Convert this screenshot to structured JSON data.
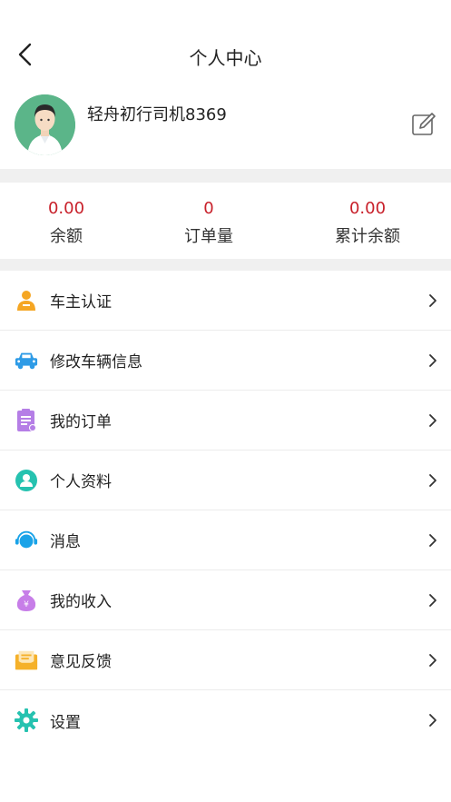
{
  "header": {
    "title": "个人中心",
    "back_icon": "back-arrow-icon"
  },
  "profile": {
    "username": "轻舟初行司机8369",
    "avatar_icon": "avatar-person-icon",
    "edit_icon": "edit-icon"
  },
  "stats": [
    {
      "value": "0.00",
      "label": "余额"
    },
    {
      "value": "0",
      "label": "订单量"
    },
    {
      "value": "0.00",
      "label": "累计余额"
    }
  ],
  "menu": [
    {
      "label": "车主认证",
      "icon": "driver-verify-icon",
      "color": "#f5a623"
    },
    {
      "label": "修改车辆信息",
      "icon": "car-icon",
      "color": "#2e9be6"
    },
    {
      "label": "我的订单",
      "icon": "order-list-icon",
      "color": "#b57ee6"
    },
    {
      "label": "个人资料",
      "icon": "profile-icon",
      "color": "#26c2b0"
    },
    {
      "label": "消息",
      "icon": "message-icon",
      "color": "#1aa3e8"
    },
    {
      "label": "我的收入",
      "icon": "money-bag-icon",
      "color": "#c77ee8"
    },
    {
      "label": "意见反馈",
      "icon": "feedback-icon",
      "color": "#f5b12a"
    },
    {
      "label": "设置",
      "icon": "settings-gear-icon",
      "color": "#26c2b0"
    }
  ],
  "colors": {
    "stat_value": "#c8202a",
    "background_gap": "#f0f0f0"
  }
}
